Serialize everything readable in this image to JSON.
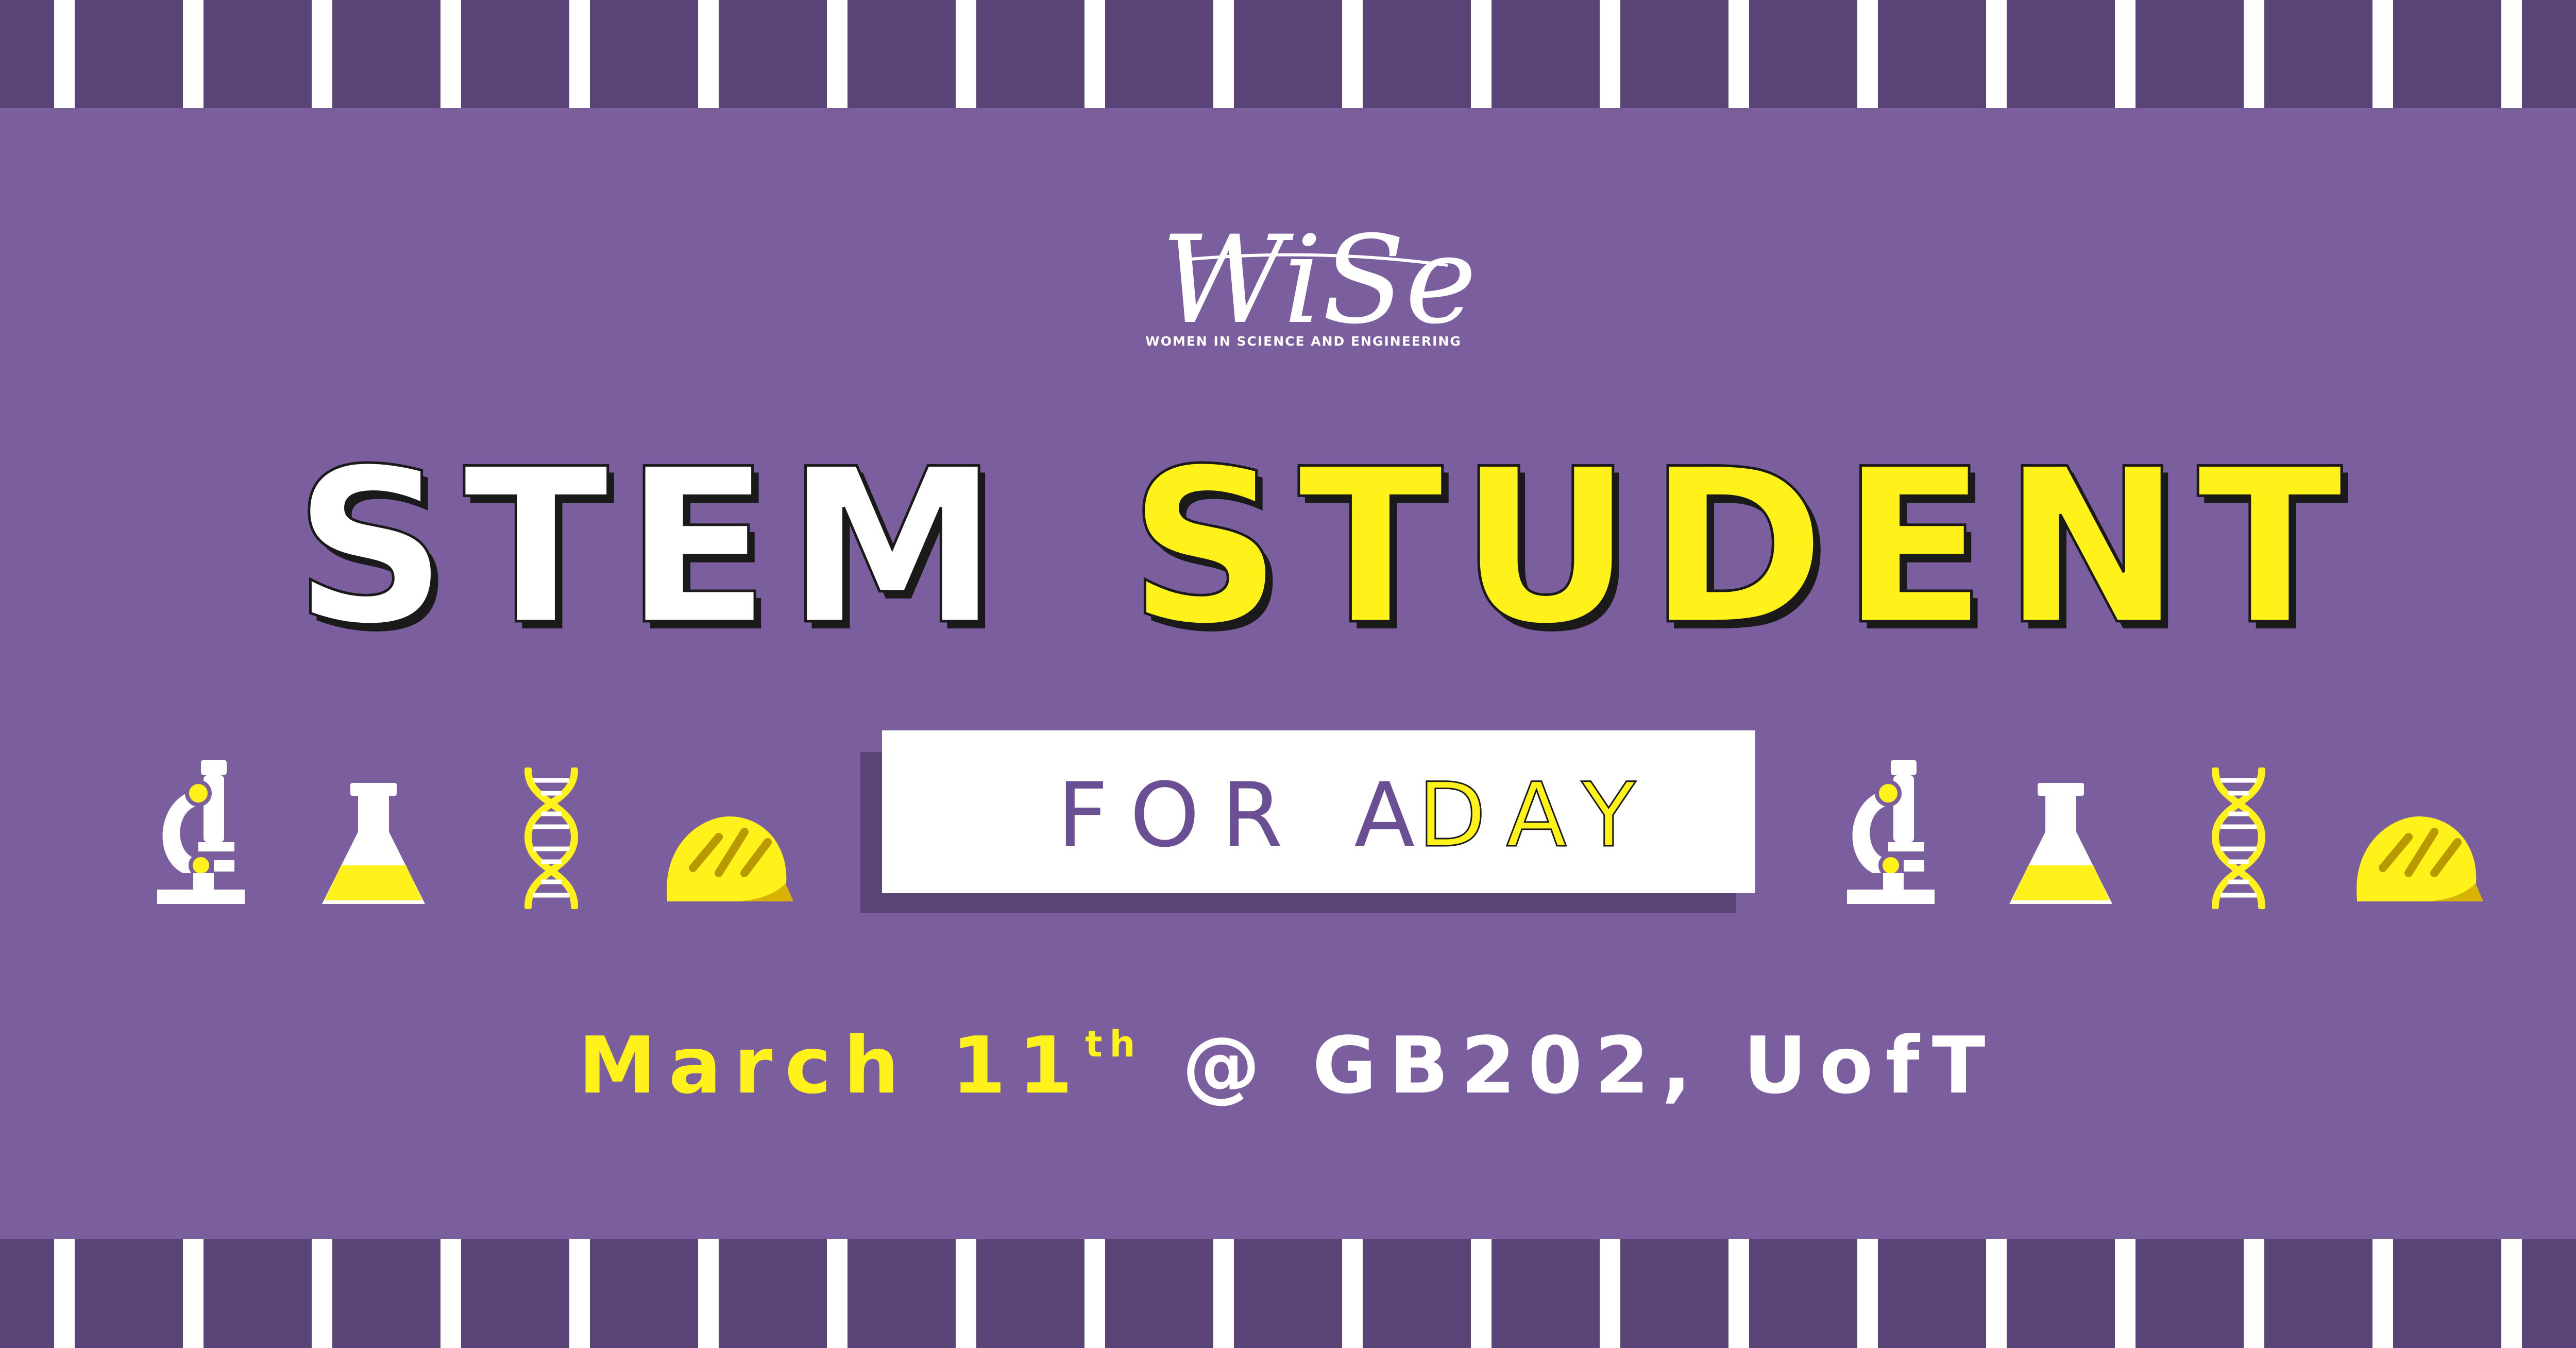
{
  "logo": {
    "wordmark": "WiSe",
    "tagline": "WOMEN IN SCIENCE AND ENGINEERING"
  },
  "headline": {
    "word1": "STEM",
    "word2": "STUDENT"
  },
  "subtitle": {
    "part1": "FOR A",
    "part2": "DAY"
  },
  "event": {
    "date": "March 11",
    "suffix": "th",
    "separator": "@",
    "location": "GB202, UofT"
  },
  "icons": [
    "microscope-icon",
    "flask-icon",
    "dna-icon",
    "hard-hat-icon",
    "microscope-icon",
    "flask-icon",
    "dna-icon",
    "hard-hat-icon"
  ],
  "colors": {
    "background": "#7b5e9e",
    "stripe_band": "#5a4477",
    "stripe": "#ffffff",
    "accent_yellow": "#fff21a",
    "text_purple": "#6b4f94",
    "outline": "#1a1a1a"
  }
}
